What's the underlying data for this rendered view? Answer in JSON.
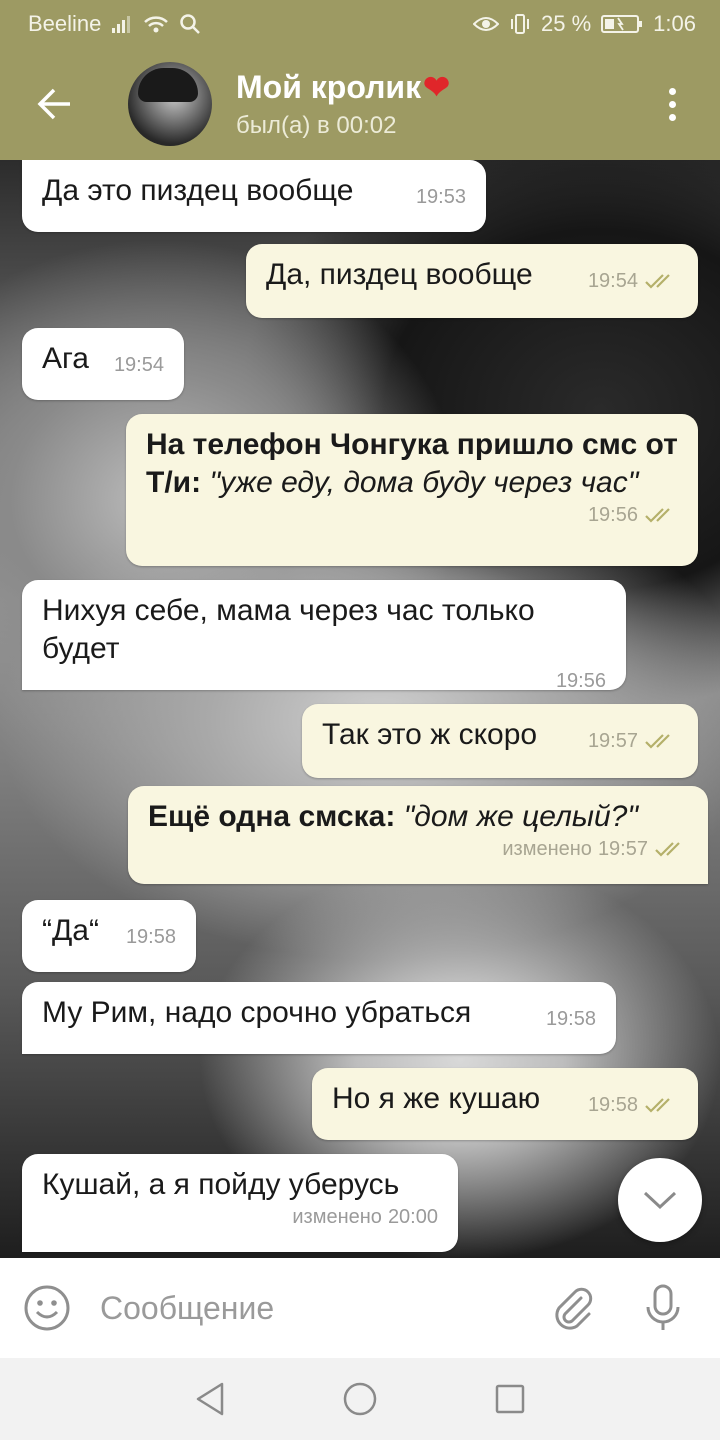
{
  "status_bar": {
    "carrier": "Beeline",
    "battery": "25 %",
    "time": "1:06"
  },
  "header": {
    "title": "Мой кролик",
    "title_emoji": "❤",
    "status": "был(а) в 00:02"
  },
  "messages": [
    {
      "dir": "in",
      "text": "Да это пиздец вообще",
      "time": "19:53"
    },
    {
      "dir": "out",
      "text": "Да, пиздец вообще",
      "time": "19:54"
    },
    {
      "dir": "in",
      "text": "Ага",
      "time": "19:54"
    },
    {
      "dir": "out",
      "bold": "На телефон Чонгука пришло смс от Т/и:",
      "italic": "\"уже еду, дома буду через час\"",
      "time": "19:56"
    },
    {
      "dir": "in",
      "text": "Нихуя себе, мама через час только будет",
      "time": "19:56"
    },
    {
      "dir": "out",
      "text": "Так это ж скоро",
      "time": "19:57"
    },
    {
      "dir": "out",
      "bold": "Ещё одна смска:",
      "italic": "\"дом же целый?\"",
      "edited": "изменено",
      "time": "19:57"
    },
    {
      "dir": "in",
      "text": "“Да“",
      "time": "19:58"
    },
    {
      "dir": "in",
      "text": "Му Рим, надо срочно убраться",
      "time": "19:58"
    },
    {
      "dir": "out",
      "text": "Но я же кушаю",
      "time": "19:58"
    },
    {
      "dir": "in",
      "text": "Кушай, а я пойду уберусь",
      "edited": "изменено",
      "time": "20:00"
    }
  ],
  "input": {
    "placeholder": "Сообщение"
  },
  "colors": {
    "header_bg": "#9d9a63",
    "outgoing_bubble": "#f9f6e0",
    "incoming_bubble": "#ffffff",
    "read_check": "#b5b06a"
  },
  "icons": [
    "back-arrow-icon",
    "more-vert-icon",
    "double-check-icon",
    "chevron-down-icon",
    "smile-icon",
    "paperclip-icon",
    "mic-icon",
    "nav-back-icon",
    "nav-home-icon",
    "nav-recents-icon"
  ]
}
